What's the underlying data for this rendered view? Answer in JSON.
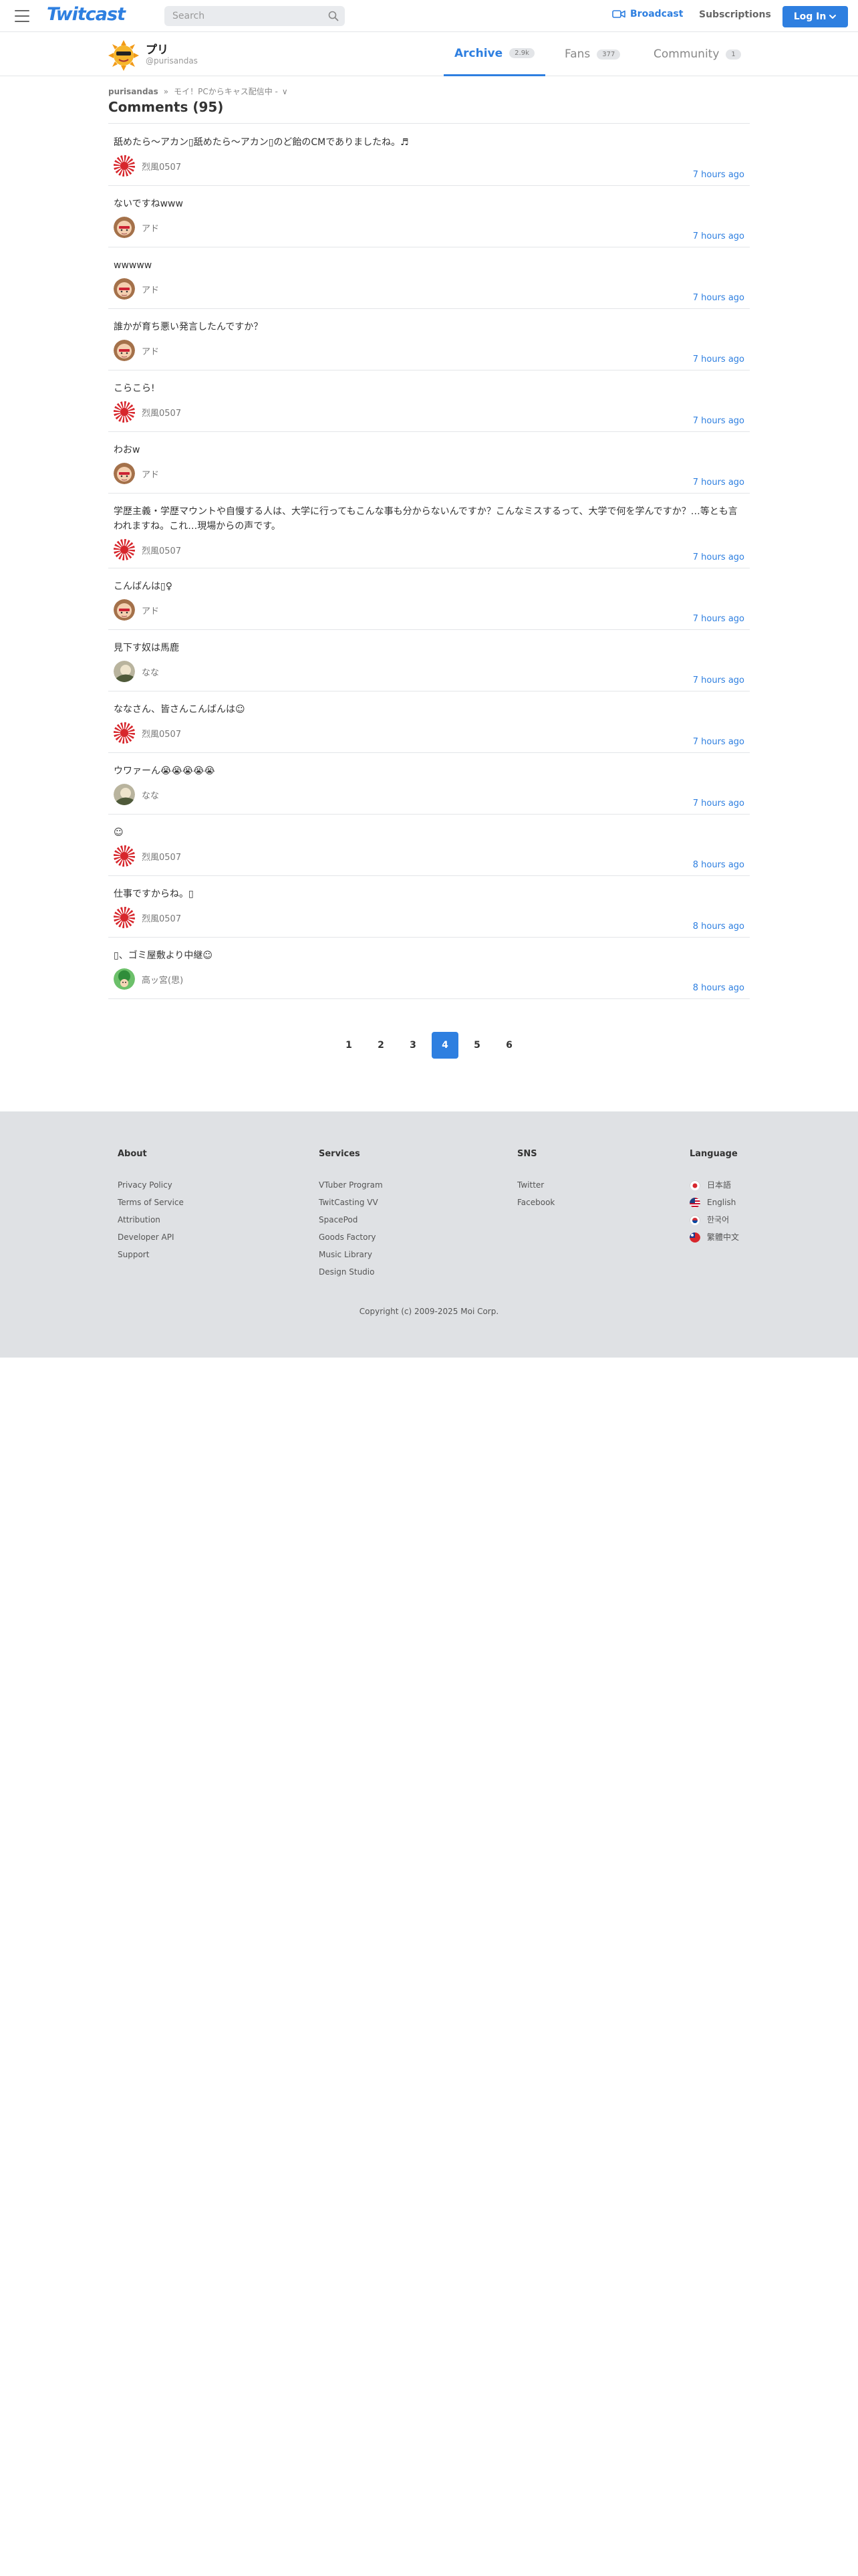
{
  "nav": {
    "logo": "Twitcast",
    "search_placeholder": "Search",
    "broadcast": "Broadcast",
    "subscriptions": "Subscriptions",
    "login": "Log In"
  },
  "profile": {
    "name": "プリ",
    "handle": "@purisandas",
    "tabs": [
      {
        "label": "Archive",
        "count": "2.9k"
      },
      {
        "label": "Fans",
        "count": "377"
      },
      {
        "label": "Community",
        "count": "1"
      }
    ]
  },
  "breadcrumb": {
    "user": "purisandas",
    "separator": "»",
    "movie": "モイ！PCからキャス配信中 -",
    "chevron": "∨"
  },
  "page_title": "Comments (95)",
  "comments": [
    {
      "text": "舐めたら〜アカン▯舐めたら〜アカン▯のど飴のCMでありましたね。♬",
      "author": "烈風0507",
      "avatar": "sunflag",
      "time": "7 hours ago"
    },
    {
      "text": "ないですねwww",
      "author": "アド",
      "avatar": "face",
      "time": "7 hours ago"
    },
    {
      "text": "wwwww",
      "author": "アド",
      "avatar": "face",
      "time": "7 hours ago"
    },
    {
      "text": "誰かが育ち悪い発言したんですか？",
      "author": "アド",
      "avatar": "face",
      "time": "7 hours ago"
    },
    {
      "text": "こらこら!",
      "author": "烈風0507",
      "avatar": "sunflag",
      "time": "7 hours ago"
    },
    {
      "text": "わおw",
      "author": "アド",
      "avatar": "face",
      "time": "7 hours ago"
    },
    {
      "text": "学歴主義・学歴マウントや自慢する人は、大学に行ってもこんな事も分からないんですか？こんなミスするって、大学で何を学んですか？…等とも言われますね。これ…現場からの声です。",
      "author": "烈風0507",
      "avatar": "sunflag",
      "time": "7 hours ago"
    },
    {
      "text": "こんばんは▯♀",
      "author": "アド",
      "avatar": "face",
      "time": "7 hours ago"
    },
    {
      "text": "見下す奴は馬鹿",
      "author": "なな",
      "avatar": "nana",
      "time": "7 hours ago"
    },
    {
      "text": "ななさん、皆さんこんばんは☺",
      "author": "烈風0507",
      "avatar": "sunflag",
      "time": "7 hours ago"
    },
    {
      "text": "ウワァーん😭😭😭😭😭",
      "author": "なな",
      "avatar": "nana",
      "time": "7 hours ago"
    },
    {
      "text": "☺",
      "author": "烈風0507",
      "avatar": "sunflag",
      "time": "8 hours ago"
    },
    {
      "text": "仕事ですからね。▯",
      "author": "烈風0507",
      "avatar": "sunflag",
      "time": "8 hours ago"
    },
    {
      "text": "▯、ゴミ屋敷より中継☺",
      "author": "高ッ宮(思)",
      "avatar": "green",
      "time": "8 hours ago"
    }
  ],
  "pagination": {
    "pages": [
      "1",
      "2",
      "3",
      "4",
      "5",
      "6"
    ],
    "current": "4"
  },
  "footer": {
    "columns": [
      {
        "heading": "About",
        "links": [
          "Privacy Policy",
          "Terms of Service",
          "Attribution",
          "Developer API",
          "Support"
        ]
      },
      {
        "heading": "Services",
        "links": [
          "VTuber Program",
          "TwitCasting VV",
          "SpacePod",
          "Goods Factory",
          "Music Library",
          "Design Studio"
        ]
      },
      {
        "heading": "SNS",
        "links": [
          "Twitter",
          "Facebook"
        ]
      },
      {
        "heading": "Language",
        "links": [
          "日本語",
          "English",
          "한국어",
          "繁體中文"
        ]
      }
    ],
    "copyright": "Copyright (c) 2009-2025 Moi Corp."
  },
  "colors": {
    "accent": "#2e7fe0",
    "footer_bg": "#dfe1e4",
    "divider": "#e3e5e8"
  },
  "icons": {
    "menu": "hamburger-icon",
    "search": "magnifier-icon",
    "broadcast": "camera-icon",
    "login": "chevron-down-icon"
  }
}
